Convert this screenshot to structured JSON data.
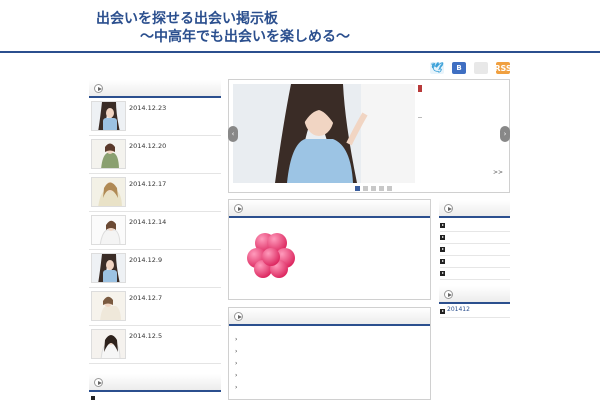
{
  "header": {
    "title_line1": "出会いを探せる出会い掲示板",
    "title_line2": "〜中高年でも出会いを楽しめる〜"
  },
  "social": {
    "twitter_glyph": "🕊",
    "hatena_label": "B",
    "rss_label": "RSS"
  },
  "recent_posts": [
    {
      "date": "2014.12.23"
    },
    {
      "date": "2014.12.20"
    },
    {
      "date": "2014.12.17"
    },
    {
      "date": "2014.12.14"
    },
    {
      "date": "2014.12.9"
    },
    {
      "date": "2014.12.7"
    },
    {
      "date": "2014.12.5"
    }
  ],
  "slider": {
    "more_label": ">>",
    "slide_count": 5,
    "active_index": 0
  },
  "archives": [
    {
      "label": "201412"
    }
  ],
  "colors": {
    "accent": "#2b4f8e",
    "clover": "#e8306a"
  }
}
